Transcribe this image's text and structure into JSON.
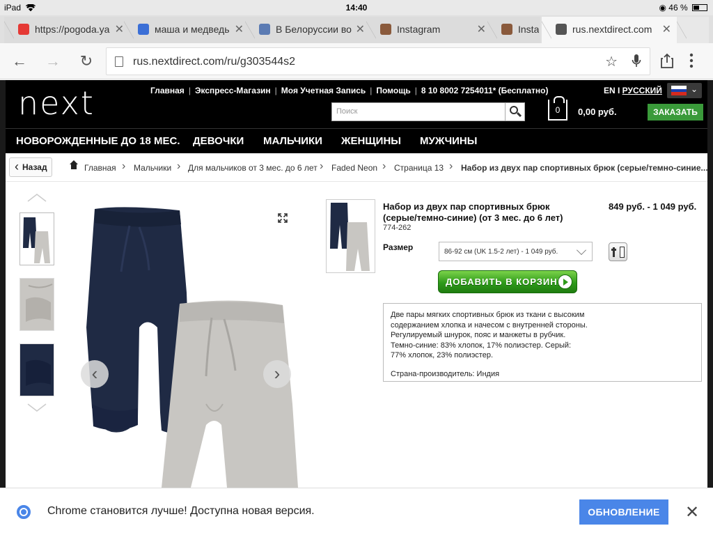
{
  "status_bar": {
    "device": "iPad",
    "time": "14:40",
    "battery": "46 %",
    "battery_level": 0.46
  },
  "tabs": [
    {
      "title": "https://pogoda.ya",
      "favicon_color": "#e53935"
    },
    {
      "title": "маша и медведь",
      "favicon_color": "#3b6fd6"
    },
    {
      "title": "В Белоруссии во",
      "favicon_color": "#5b7bb3"
    },
    {
      "title": "Instagram",
      "favicon_color": "#8a5a3c"
    },
    {
      "title": "Insta",
      "favicon_color": "#8a5a3c"
    },
    {
      "title": "rus.nextdirect.com",
      "favicon_color": "#555555",
      "active": true
    }
  ],
  "address_bar": {
    "url": "rus.nextdirect.com/ru/g303544s2"
  },
  "header": {
    "logo": "next",
    "top_links": [
      "Главная",
      "Экспресс-Магазин",
      "Моя Учетная Запись",
      "Помощь",
      "8 10 8002 7254011* (Бесплатно)"
    ],
    "lang_prefix": "EN I ",
    "lang_current": "РУССКИЙ",
    "search_placeholder": "Поиск",
    "bag_count": "0",
    "bag_total": "0,00 руб.",
    "checkout_label": "ЗАКАЗАТЬ",
    "flag_colors": [
      "#ffffff",
      "#1c3fae",
      "#d52b1e"
    ]
  },
  "nav": [
    "НОВОРОЖДЕННЫЕ ДО 18 МЕС.",
    "ДЕВОЧКИ",
    "МАЛЬЧИКИ",
    "ЖЕНЩИНЫ",
    "МУЖЧИНЫ"
  ],
  "breadcrumb": {
    "back_label": "Назад",
    "items": [
      "Главная",
      "Мальчики",
      "Для мальчиков от 3 мес. до 6 лет",
      "Faded Neon",
      "Страница 13",
      "Набор из двух пар спортивных брюк (серые/темно-синие..."
    ]
  },
  "product": {
    "title": "Набор из двух пар спортивных брюк (серые/темно-синие) (от 3 мес. до 6 лет)",
    "code": "774-262",
    "price": "849 руб. - 1 049 руб.",
    "size_label": "Размер",
    "size_value": "86-92 см (UK 1.5-2 лет) - 1 049 руб.",
    "add_to_cart_label": "ДОБАВИТЬ В КОРЗИНУ",
    "description": "Две пары мягких спортивных брюк из ткани с высоким\nсодержанием хлопка и начесом с внутренней стороны.\nРегулируемый шнурок, пояс и манжеты в рубчик.\nТемно-синие: 83% хлопок, 17% полиэстер. Серый:\n77% хлопок, 23% полиэстер.",
    "origin": "Страна-производитель: Индия",
    "colors": {
      "navy": "#1f2a44",
      "grey": "#c8c6c2"
    }
  },
  "infobar": {
    "message": "Chrome становится лучше! Доступна новая версия.",
    "update_label": "ОБНОВЛЕНИЕ"
  }
}
